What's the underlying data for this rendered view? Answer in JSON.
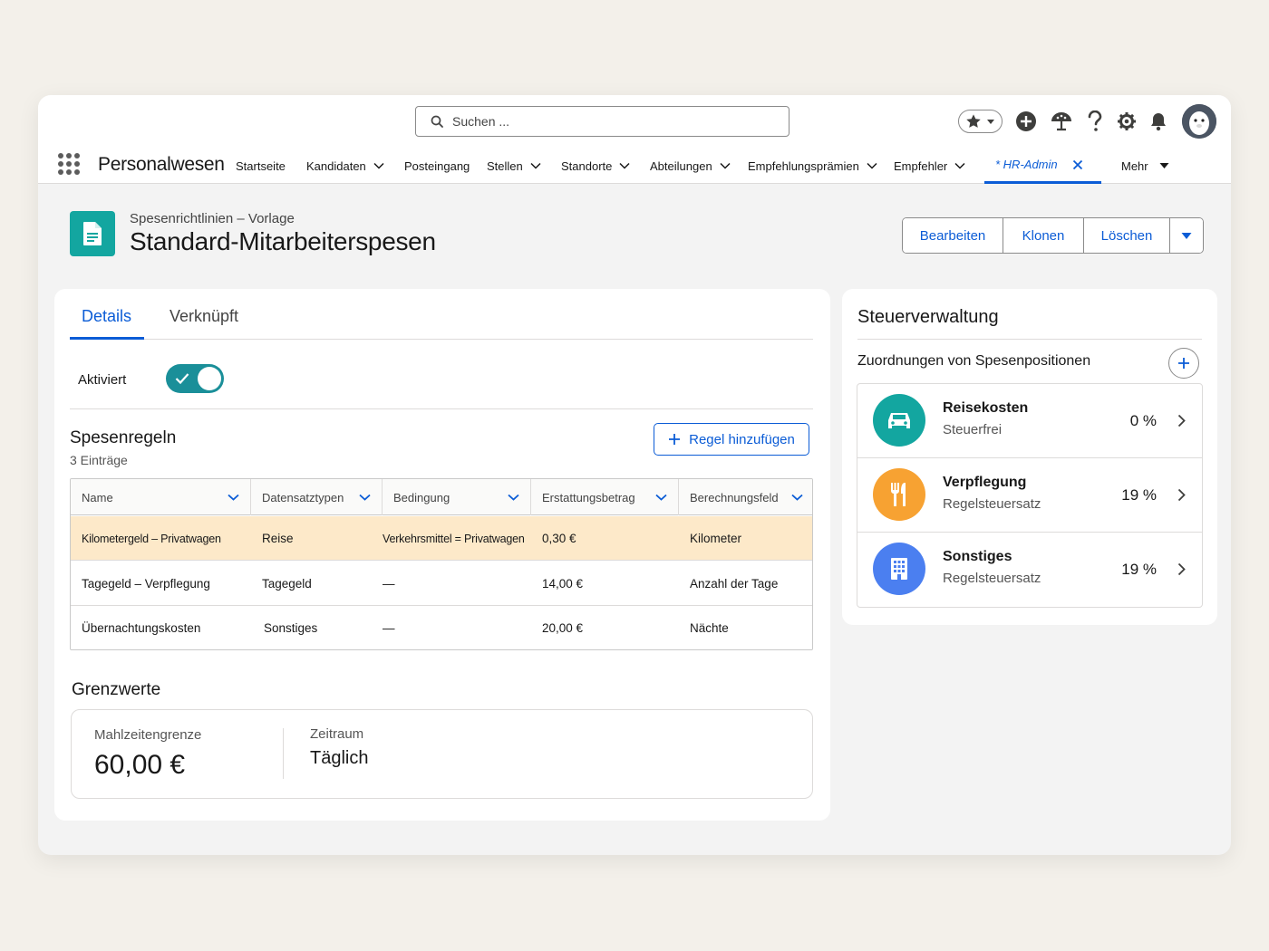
{
  "header": {
    "search_placeholder": "Suchen ...",
    "app_name": "Personalwesen",
    "nav": [
      {
        "label": "Startseite",
        "dropdown": false
      },
      {
        "label": "Kandidaten",
        "dropdown": true
      },
      {
        "label": "Posteingang",
        "dropdown": false
      },
      {
        "label": "Stellen",
        "dropdown": true
      },
      {
        "label": "Standorte",
        "dropdown": true
      },
      {
        "label": "Abteilungen",
        "dropdown": true
      },
      {
        "label": "Empfehlungsprämien",
        "dropdown": true
      },
      {
        "label": "Empfehler",
        "dropdown": true
      }
    ],
    "active_tab": "* HR-Admin",
    "more_label": "Mehr",
    "icons": [
      "star-icon",
      "add-icon",
      "trailhead-icon",
      "help-icon",
      "setup-gear-icon",
      "notifications-bell-icon",
      "avatar"
    ]
  },
  "record": {
    "object_label": "Spesenrichtlinien – Vorlage",
    "title": "Standard-Mitarbeiterspesen",
    "actions": [
      "Bearbeiten",
      "Klonen",
      "Löschen"
    ]
  },
  "details": {
    "tabs": [
      "Details",
      "Verknüpft"
    ],
    "active_tab_index": 0,
    "toggle_label": "Aktiviert",
    "toggle_on": true,
    "rules": {
      "title": "Spesenregeln",
      "count": "3 Einträge",
      "add_label": "Regel hinzufügen",
      "columns": [
        "Name",
        "Datensatztypen",
        "Bedingung",
        "Erstattungsbetrag",
        "Berechnungsfeld"
      ],
      "rows": [
        [
          "Kilometergeld – Privatwagen",
          "Reise",
          "Verkehrsmittel = Privatwagen",
          "0,30 €",
          "Kilometer"
        ],
        [
          "Tagegeld – Verpflegung",
          "Tagegeld",
          "—",
          "14,00 €",
          "Anzahl der Tage"
        ],
        [
          "Übernachtungskosten",
          "Sonstiges",
          "—",
          "20,00 €",
          "Nächte"
        ]
      ],
      "highlighted_row_index": 0
    },
    "limits": {
      "title": "Grenzwerte",
      "meal_limit_label": "Mahlzeitengrenze",
      "meal_limit_value": "60,00 €",
      "period_label": "Zeitraum",
      "period_value": "Täglich"
    }
  },
  "tax": {
    "title": "Steuerverwaltung",
    "subtitle": "Zuordnungen von Spesenpositionen",
    "items": [
      {
        "name": "Reisekosten",
        "desc": "Steuerfrei",
        "pct": "0 %",
        "icon": "car-icon",
        "color": "#13a6a0"
      },
      {
        "name": "Verpflegung",
        "desc": "Regelsteuersatz",
        "pct": "19 %",
        "icon": "fork-knife-icon",
        "color": "#f7a232"
      },
      {
        "name": "Sonstiges",
        "desc": "Regelsteuersatz",
        "pct": "19 %",
        "icon": "building-icon",
        "color": "#4b7ff0"
      }
    ]
  },
  "colors": {
    "brand_blue": "#0b5cd6",
    "teal": "#13a6a0",
    "highlight_row": "#fde9c9"
  }
}
